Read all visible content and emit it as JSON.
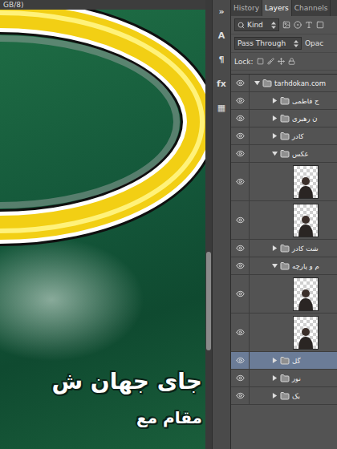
{
  "document_tab": {
    "title": "GB/8)"
  },
  "canvas": {
    "texts": [
      "جای جهان ش",
      "مقام مع"
    ]
  },
  "scrollbar": {
    "level": 0.72,
    "size": 0.22
  },
  "panel_strip": {
    "buttons": [
      "»",
      "A",
      "¶",
      "fx",
      "▦"
    ]
  },
  "panel": {
    "tabs": [
      {
        "label": "History",
        "selected": false
      },
      {
        "label": "Layers",
        "selected": true
      },
      {
        "label": "Channels",
        "selected": false
      }
    ],
    "filter": {
      "label": "Kind"
    },
    "blend_mode": "Pass Through",
    "opacity_label": "Opac",
    "lock_label": "Lock:"
  },
  "layers": [
    {
      "kind": "group",
      "name": "tarhdokan.com",
      "depth": 0,
      "expanded": true,
      "visible": true,
      "selected": false
    },
    {
      "kind": "group",
      "name": "ج فاطمی",
      "depth": 1,
      "expanded": false,
      "visible": true,
      "selected": false
    },
    {
      "kind": "group",
      "name": "ن رهبری",
      "depth": 1,
      "expanded": false,
      "visible": true,
      "selected": false
    },
    {
      "kind": "group",
      "name": "کادر",
      "depth": 1,
      "expanded": false,
      "visible": true,
      "selected": false
    },
    {
      "kind": "group",
      "name": "عکس",
      "depth": 1,
      "expanded": true,
      "visible": true,
      "selected": false
    },
    {
      "kind": "image",
      "depth": 2,
      "visible": true,
      "selected": false
    },
    {
      "kind": "image",
      "depth": 2,
      "visible": true,
      "selected": false
    },
    {
      "kind": "group",
      "name": "شت کادر",
      "depth": 1,
      "expanded": false,
      "visible": true,
      "selected": false
    },
    {
      "kind": "group",
      "name": "م و پارچه",
      "depth": 1,
      "expanded": true,
      "visible": true,
      "selected": false
    },
    {
      "kind": "image",
      "depth": 2,
      "visible": true,
      "selected": false
    },
    {
      "kind": "image",
      "depth": 2,
      "visible": true,
      "selected": false
    },
    {
      "kind": "group",
      "name": "گل",
      "depth": 1,
      "expanded": false,
      "visible": true,
      "selected": true
    },
    {
      "kind": "group",
      "name": "نور",
      "depth": 1,
      "expanded": false,
      "visible": true,
      "selected": false
    },
    {
      "kind": "group",
      "name": "بک",
      "depth": 1,
      "expanded": false,
      "visible": true,
      "selected": false
    }
  ]
}
